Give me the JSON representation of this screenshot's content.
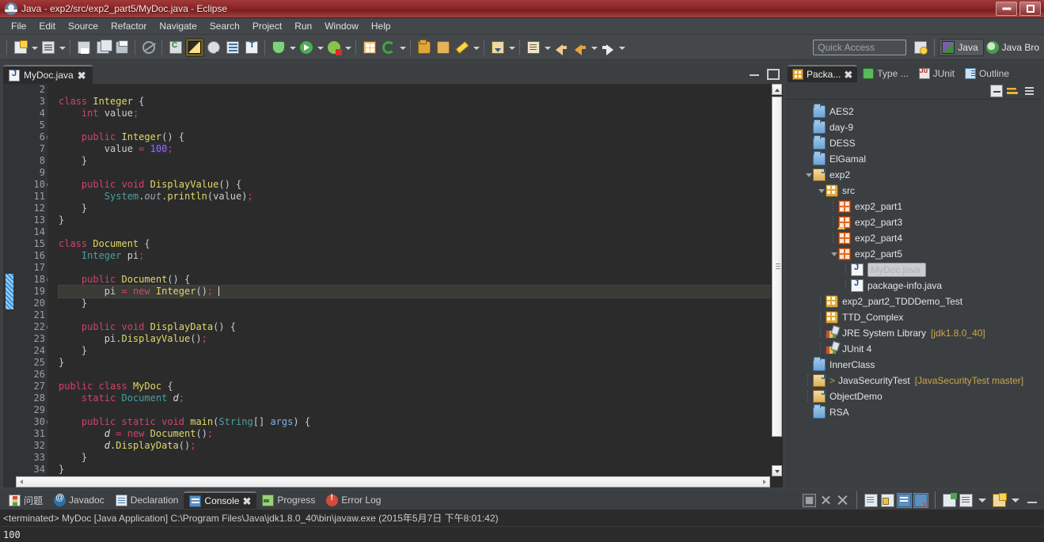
{
  "window": {
    "title": "Java - exp2/src/exp2_part5/MyDoc.java - Eclipse",
    "icon": "eclipse-icon",
    "minimize_label": "",
    "maximize_label": ""
  },
  "menubar": {
    "items": [
      "File",
      "Edit",
      "Source",
      "Refactor",
      "Navigate",
      "Search",
      "Project",
      "Run",
      "Window",
      "Help"
    ]
  },
  "toolbar": {
    "quick_access_placeholder": "Quick Access",
    "buttons": [
      {
        "name": "new-button",
        "icon": "new-wizard-icon"
      },
      {
        "name": "new-dropdown",
        "icon": "chevron-down-icon"
      },
      {
        "name": "new-java-file-button",
        "icon": "new-java-file-icon"
      },
      {
        "name": "new-java-dropdown",
        "icon": "chevron-down-icon"
      },
      {
        "name": "save-button",
        "icon": "save-icon"
      },
      {
        "name": "save-all-button",
        "icon": "save-all-icon"
      },
      {
        "name": "print-button",
        "icon": "print-icon"
      },
      {
        "name": "toggle-mark-occurrences-button",
        "icon": "no-write-icon"
      },
      {
        "name": "new-class-button",
        "icon": "new-class-icon"
      },
      {
        "name": "skip-all-breakpoints-button",
        "icon": "breakpoint-skip-icon"
      },
      {
        "name": "open-type-button",
        "icon": "open-type-icon"
      },
      {
        "name": "open-task-button",
        "icon": "open-task-icon"
      },
      {
        "name": "debug-button",
        "icon": "debug-icon"
      },
      {
        "name": "debug-dropdown",
        "icon": "chevron-down-icon"
      },
      {
        "name": "run-button",
        "icon": "run-icon"
      },
      {
        "name": "run-dropdown",
        "icon": "chevron-down-icon"
      },
      {
        "name": "run-as-button",
        "icon": "external-tools-icon"
      },
      {
        "name": "run-as-dropdown",
        "icon": "chevron-down-icon"
      },
      {
        "name": "new-java-project-button",
        "icon": "new-java-project-icon"
      },
      {
        "name": "refresh-button",
        "icon": "refresh-icon"
      },
      {
        "name": "refresh-dropdown",
        "icon": "chevron-down-icon"
      },
      {
        "name": "open-resource-button",
        "icon": "folder-open-icon"
      },
      {
        "name": "search-button",
        "icon": "folder-icon"
      },
      {
        "name": "edit-button",
        "icon": "pencil-icon"
      },
      {
        "name": "edit-dropdown",
        "icon": "chevron-down-icon"
      },
      {
        "name": "next-edit-button",
        "icon": "next-edit-icon"
      },
      {
        "name": "next-edit-dropdown",
        "icon": "chevron-down-icon"
      },
      {
        "name": "annotation-button",
        "icon": "annotation-icon"
      },
      {
        "name": "annotation-dropdown",
        "icon": "chevron-down-icon"
      },
      {
        "name": "back-button",
        "icon": "back-arrow-icon"
      },
      {
        "name": "previous-button",
        "icon": "back-arrow-icon"
      },
      {
        "name": "previous-dropdown",
        "icon": "chevron-down-icon"
      },
      {
        "name": "forward-button",
        "icon": "forward-arrow-icon"
      },
      {
        "name": "forward-dropdown",
        "icon": "chevron-down-icon"
      }
    ],
    "perspectives": [
      {
        "name": "open-perspective-button",
        "label": "",
        "icon": "open-perspective-icon",
        "active": false
      },
      {
        "name": "perspective-java",
        "label": "Java",
        "icon": "java-perspective-icon",
        "active": true
      },
      {
        "name": "perspective-java-browsing",
        "label": "Java Bro",
        "icon": "java-browsing-icon",
        "active": false
      }
    ]
  },
  "editor": {
    "tab": {
      "label": "MyDoc.java",
      "icon": "java-file-icon",
      "close": "✖"
    },
    "panel_minimize": "minimize-icon",
    "panel_maximize": "maximize-icon",
    "current_line": 19,
    "lines": [
      {
        "n": 2,
        "fold": false,
        "text": ""
      },
      {
        "n": 3,
        "fold": false,
        "text": "class Integer {"
      },
      {
        "n": 4,
        "fold": false,
        "text": "    int value;"
      },
      {
        "n": 5,
        "fold": false,
        "text": ""
      },
      {
        "n": 6,
        "fold": true,
        "text": "    public Integer() {"
      },
      {
        "n": 7,
        "fold": false,
        "text": "        value = 100;"
      },
      {
        "n": 8,
        "fold": false,
        "text": "    }"
      },
      {
        "n": 9,
        "fold": false,
        "text": ""
      },
      {
        "n": 10,
        "fold": true,
        "text": "    public void DisplayValue() {"
      },
      {
        "n": 11,
        "fold": false,
        "text": "        System.out.println(value);"
      },
      {
        "n": 12,
        "fold": false,
        "text": "    }"
      },
      {
        "n": 13,
        "fold": false,
        "text": "}"
      },
      {
        "n": 14,
        "fold": false,
        "text": ""
      },
      {
        "n": 15,
        "fold": false,
        "text": "class Document {"
      },
      {
        "n": 16,
        "fold": false,
        "text": "    Integer pi;"
      },
      {
        "n": 17,
        "fold": false,
        "text": ""
      },
      {
        "n": 18,
        "fold": true,
        "text": "    public Document() {"
      },
      {
        "n": 19,
        "fold": false,
        "text": "        pi = new Integer();"
      },
      {
        "n": 20,
        "fold": false,
        "text": "    }"
      },
      {
        "n": 21,
        "fold": false,
        "text": ""
      },
      {
        "n": 22,
        "fold": true,
        "text": "    public void DisplayData() {"
      },
      {
        "n": 23,
        "fold": false,
        "text": "        pi.DisplayValue();"
      },
      {
        "n": 24,
        "fold": false,
        "text": "    }"
      },
      {
        "n": 25,
        "fold": false,
        "text": "}"
      },
      {
        "n": 26,
        "fold": false,
        "text": ""
      },
      {
        "n": 27,
        "fold": false,
        "text": "public class MyDoc {"
      },
      {
        "n": 28,
        "fold": false,
        "text": "    static Document d;"
      },
      {
        "n": 29,
        "fold": false,
        "text": ""
      },
      {
        "n": 30,
        "fold": true,
        "text": "    public static void main(String[] args) {"
      },
      {
        "n": 31,
        "fold": false,
        "text": "        d = new Document();"
      },
      {
        "n": 32,
        "fold": false,
        "text": "        d.DisplayData();"
      },
      {
        "n": 33,
        "fold": false,
        "text": "    }"
      },
      {
        "n": 34,
        "fold": false,
        "text": "}"
      }
    ]
  },
  "package_explorer": {
    "tabs": [
      {
        "name": "tab-package-explorer",
        "label": "Packa...",
        "icon": "package-explorer-icon",
        "active": true,
        "close": "✖"
      },
      {
        "name": "tab-type-hierarchy",
        "label": "Type ...",
        "icon": "type-hierarchy-icon",
        "active": false
      },
      {
        "name": "tab-junit",
        "label": "JUnit",
        "icon": "junit-icon",
        "active": false
      },
      {
        "name": "tab-outline",
        "label": "Outline",
        "icon": "outline-icon",
        "active": false
      }
    ],
    "toolbar": [
      {
        "name": "collapse-all-button",
        "icon": "collapse-all-icon"
      },
      {
        "name": "link-with-editor-button",
        "icon": "link-editor-icon"
      },
      {
        "name": "view-menu-button",
        "icon": "view-menu-icon"
      }
    ],
    "tree": [
      {
        "label": "AES2",
        "icon": "folder-icon",
        "indent": 1,
        "twist": "none",
        "selected": false,
        "decoration": ""
      },
      {
        "label": "day-9",
        "icon": "folder-icon",
        "indent": 1,
        "twist": "none",
        "selected": false,
        "decoration": ""
      },
      {
        "label": "DESS",
        "icon": "folder-icon",
        "indent": 1,
        "twist": "none",
        "selected": false,
        "decoration": ""
      },
      {
        "label": "ElGamal",
        "icon": "folder-icon",
        "indent": 1,
        "twist": "none",
        "selected": false,
        "decoration": ""
      },
      {
        "label": "exp2",
        "icon": "java-project-icon",
        "indent": 1,
        "twist": "open",
        "selected": false,
        "decoration": ""
      },
      {
        "label": "src",
        "icon": "source-folder-icon",
        "indent": 2,
        "twist": "open",
        "selected": false,
        "decoration": ""
      },
      {
        "label": "exp2_part1",
        "icon": "package-icon",
        "indent": 3,
        "twist": "dots",
        "selected": false,
        "decoration": ""
      },
      {
        "label": "exp2_part3",
        "icon": "package-warning-icon",
        "indent": 3,
        "twist": "dots",
        "selected": false,
        "decoration": ""
      },
      {
        "label": "exp2_part4",
        "icon": "package-icon",
        "indent": 3,
        "twist": "dots",
        "selected": false,
        "decoration": ""
      },
      {
        "label": "exp2_part5",
        "icon": "package-icon",
        "indent": 3,
        "twist": "open",
        "selected": false,
        "decoration": ""
      },
      {
        "label": "MyDoc.java",
        "icon": "java-file-icon",
        "indent": 4,
        "twist": "dots",
        "selected": true,
        "decoration": ""
      },
      {
        "label": "package-info.java",
        "icon": "java-file-icon",
        "indent": 4,
        "twist": "dots",
        "selected": false,
        "decoration": ""
      },
      {
        "label": "exp2_part2_TDDDemo_Test",
        "icon": "source-folder-icon",
        "indent": 2,
        "twist": "dots",
        "selected": false,
        "decoration": ""
      },
      {
        "label": "TTD_Complex",
        "icon": "source-folder-icon",
        "indent": 2,
        "twist": "dots",
        "selected": false,
        "decoration": ""
      },
      {
        "label": "JRE System Library",
        "icon": "library-icon",
        "indent": 2,
        "twist": "dots",
        "selected": false,
        "decoration": "[jdk1.8.0_40]"
      },
      {
        "label": "JUnit 4",
        "icon": "library-icon",
        "indent": 2,
        "twist": "dots",
        "selected": false,
        "decoration": ""
      },
      {
        "label": "InnerClass",
        "icon": "folder-icon",
        "indent": 1,
        "twist": "none",
        "selected": false,
        "decoration": ""
      },
      {
        "label": "JavaSecurityTest",
        "icon": "java-project-icon",
        "indent": 1,
        "twist": "dots",
        "selected": false,
        "decoration": "[JavaSecurityTest master]",
        "prefix": ">"
      },
      {
        "label": "ObjectDemo",
        "icon": "java-project-icon",
        "indent": 1,
        "twist": "dots",
        "selected": false,
        "decoration": ""
      },
      {
        "label": "RSA",
        "icon": "folder-icon",
        "indent": 1,
        "twist": "none",
        "selected": false,
        "decoration": ""
      }
    ]
  },
  "console": {
    "tabs": [
      {
        "name": "tab-problems",
        "label": "问题",
        "icon": "problems-icon",
        "active": false
      },
      {
        "name": "tab-javadoc",
        "label": "Javadoc",
        "icon": "javadoc-icon",
        "active": false
      },
      {
        "name": "tab-declaration",
        "label": "Declaration",
        "icon": "declaration-icon",
        "active": false
      },
      {
        "name": "tab-console",
        "label": "Console",
        "icon": "console-icon",
        "active": true,
        "close": "✖"
      },
      {
        "name": "tab-progress",
        "label": "Progress",
        "icon": "progress-icon",
        "active": false
      },
      {
        "name": "tab-error-log",
        "label": "Error Log",
        "icon": "error-log-icon",
        "active": false
      }
    ],
    "toolbar": [
      {
        "name": "terminate-button",
        "icon": "terminate-icon"
      },
      {
        "name": "remove-launch-button",
        "icon": "remove-icon"
      },
      {
        "name": "remove-all-launches-button",
        "icon": "remove-all-icon"
      },
      {
        "name": "clear-console-button",
        "icon": "clear-console-icon"
      },
      {
        "name": "scroll-lock-button",
        "icon": "scroll-lock-icon"
      },
      {
        "name": "pin-console-button",
        "icon": "pin-console-icon"
      },
      {
        "name": "close-console-button",
        "icon": "close-console-icon"
      },
      {
        "name": "open-console-button",
        "icon": "open-console-icon"
      },
      {
        "name": "display-selected-console-button",
        "icon": "display-console-icon"
      },
      {
        "name": "display-console-dropdown",
        "icon": "chevron-down-icon"
      },
      {
        "name": "new-console-view-button",
        "icon": "new-console-view-icon"
      },
      {
        "name": "view-menu-button",
        "icon": "view-menu-icon"
      },
      {
        "name": "minimize-view-button",
        "icon": "minimize-icon"
      }
    ],
    "status_line": "<terminated> MyDoc [Java Application] C:\\Program Files\\Java\\jdk1.8.0_40\\bin\\javaw.exe (2015年5月7日 下午8:01:42)",
    "output": "100"
  },
  "colors": {
    "titlebar": "#8e2727",
    "chrome": "#44484b",
    "editor_bg": "#2b2b2b",
    "gutter_bg": "#313335",
    "keyword": "#cc7832",
    "keyword_pink": "#d1436b",
    "type": "#49a0a0",
    "class_name": "#dfd96a",
    "number": "#9370d8",
    "selection": "#c9ccd0",
    "change_bar": "#4a9fe0"
  }
}
